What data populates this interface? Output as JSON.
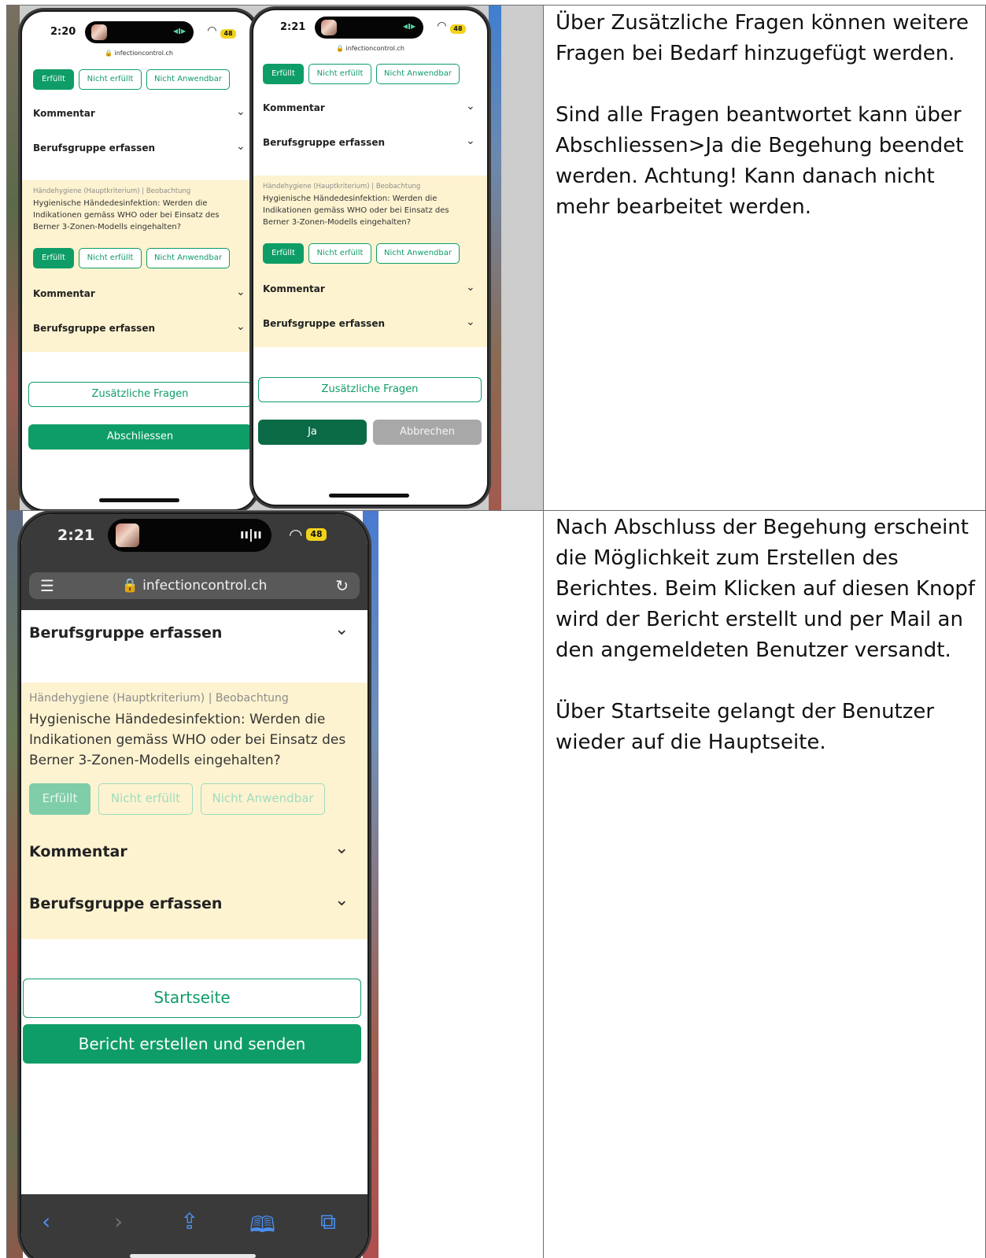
{
  "rows": [
    {
      "text": [
        "Über Zusätzliche Fragen können weitere Fragen bei Bedarf hinzugefügt werden.",
        "Sind alle Fragen beantwortet kann über Abschliessen>Ja die Begehung beendet werden. Achtung! Kann danach nicht mehr bearbeitet werden."
      ],
      "phones": [
        {
          "time": "2:20",
          "battery": "48",
          "url": "infectioncontrol.ch",
          "buttons": [
            "Erfüllt",
            "Nicht erfüllt",
            "Nicht Anwendbar"
          ],
          "comment_label": "Kommentar",
          "group_label": "Berufsgruppe erfassen",
          "category": "Händehygiene (Hauptkriterium) | Beobachtung",
          "question": "Hygienische Händedesinfektion: Werden die Indikationen gemäss WHO oder bei Einsatz des Berner 3-Zonen-Modells eingehalten?",
          "extra_button": "Zusätzliche Fragen",
          "finish_button": "Abschliessen"
        },
        {
          "time": "2:21",
          "battery": "48",
          "url": "infectioncontrol.ch",
          "buttons": [
            "Erfüllt",
            "Nicht erfüllt",
            "Nicht Anwendbar"
          ],
          "comment_label": "Kommentar",
          "group_label": "Berufsgruppe erfassen",
          "category": "Händehygiene (Hauptkriterium) | Beobachtung",
          "question": "Hygienische Händedesinfektion: Werden die Indikationen gemäss WHO oder bei Einsatz des Berner 3-Zonen-Modells eingehalten?",
          "extra_button": "Zusätzliche Fragen",
          "yes_button": "Ja",
          "cancel_button": "Abbrechen"
        }
      ]
    },
    {
      "text": [
        "Nach Abschluss der Begehung erscheint die Möglichkeit zum Erstellen des Berichtes. Beim Klicken auf diesen Knopf wird der Bericht erstellt und per Mail an den angemeldeten Benutzer versandt.",
        "Über Startseite gelangt der Benutzer wieder auf die Hauptseite."
      ],
      "phone": {
        "time": "2:21",
        "battery": "48",
        "url": "infectioncontrol.ch",
        "group_label": "Berufsgruppe erfassen",
        "category": "Händehygiene (Hauptkriterium) | Beobachtung",
        "question": "Hygienische Händedesinfektion: Werden die Indikationen gemäss WHO oder bei Einsatz des Berner 3-Zonen-Modells eingehalten?",
        "buttons": [
          "Erfüllt",
          "Nicht erfüllt",
          "Nicht Anwendbar"
        ],
        "comment_label": "Kommentar",
        "group_label_2": "Berufsgruppe erfassen",
        "home_button": "Startseite",
        "report_button": "Bericht erstellen und senden"
      }
    }
  ],
  "colors": {
    "accent": "#0f9d67",
    "card_bg": "#fdf3d0",
    "cell_bg": "#cccccc"
  }
}
